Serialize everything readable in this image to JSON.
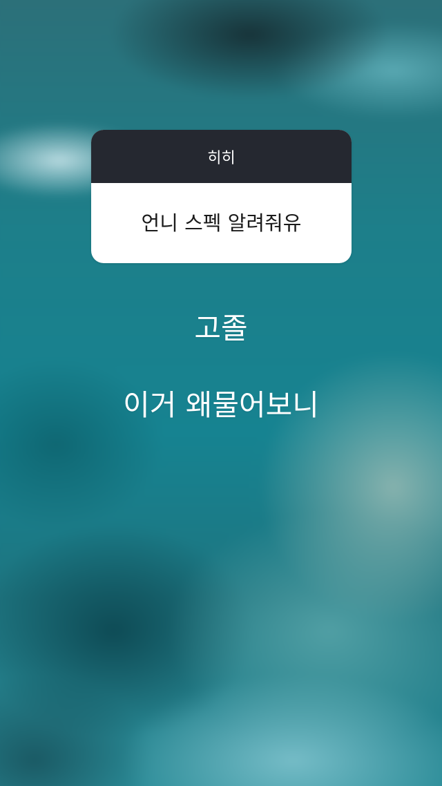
{
  "question_box": {
    "header": "히히",
    "question": "언니 스펙 알려줘유"
  },
  "answer": {
    "line1": "고졸",
    "line2": "이거 왜물어보니"
  },
  "colors": {
    "header_bg": "#252830",
    "box_bg": "#ffffff",
    "text_on_bg": "#ffffff"
  }
}
